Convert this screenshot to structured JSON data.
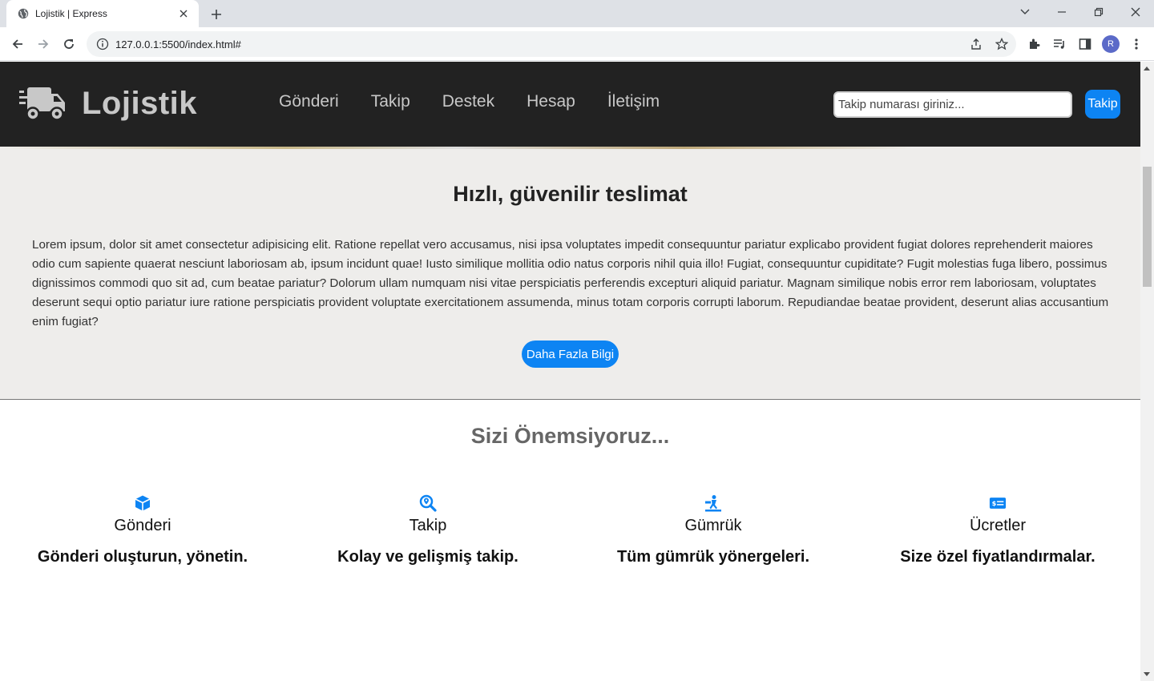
{
  "browser": {
    "tab_title": "Lojistik | Express",
    "url": "127.0.0.1:5500/index.html#",
    "profile_initial": "R"
  },
  "navbar": {
    "brand": "Lojistik",
    "links": [
      "Gönderi",
      "Takip",
      "Destek",
      "Hesap",
      "İletişim"
    ],
    "search_placeholder": "Takip numarası giriniz...",
    "track_button": "Takip"
  },
  "hero": {
    "title": "Hızlı, güvenilir teslimat",
    "body": "Lorem ipsum, dolor sit amet consectetur adipisicing elit. Ratione repellat vero accusamus, nisi ipsa voluptates impedit consequuntur pariatur explicabo provident fugiat dolores reprehenderit maiores odio cum sapiente quaerat nesciunt laboriosam ab, ipsum incidunt quae! Iusto similique mollitia odio natus corporis nihil quia illo! Fugiat, consequuntur cupiditate? Fugit molestias fuga libero, possimus dignissimos commodi quo sit ad, cum beatae pariatur? Dolorum ullam numquam nisi vitae perspiciatis perferendis excepturi aliquid pariatur. Magnam similique nobis error rem laboriosam, voluptates deserunt sequi optio pariatur iure ratione perspiciatis provident voluptate exercitationem assumenda, minus totam corporis corrupti laborum. Repudiandae beatae provident, deserunt alias accusantium enim fugiat?",
    "button": "Daha Fazla Bilgi"
  },
  "features": {
    "title": "Sizi Önemsiyoruz...",
    "items": [
      {
        "icon": "box-icon",
        "name": "Gönderi",
        "desc": "Gönderi oluşturun, yönetin."
      },
      {
        "icon": "search-location-icon",
        "name": "Takip",
        "desc": "Kolay ve gelişmiş takip."
      },
      {
        "icon": "customs-icon",
        "name": "Gümrük",
        "desc": "Tüm gümrük yönergeleri."
      },
      {
        "icon": "money-card-icon",
        "name": "Ücretler",
        "desc": "Size özel fiyatlandırmalar."
      }
    ]
  },
  "colors": {
    "navbar_bg": "#222222",
    "accent": "#0d84f3",
    "hero_bg": "#eeedeb"
  }
}
